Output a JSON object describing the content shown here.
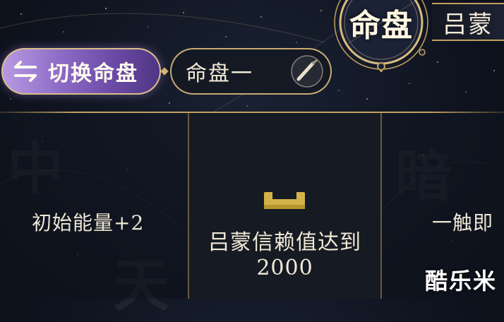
{
  "header": {
    "switch_label": "切换命盘",
    "chart_name": "命盘一",
    "medallion_title": "命盘",
    "character_name": "吕蒙"
  },
  "panels": {
    "left_text": "初始能量+2",
    "mid_line1": "吕蒙信赖值达到",
    "mid_line2": "2000",
    "right_text": "一触即"
  },
  "watermark": "酷乐米",
  "icons": {
    "switch": "swap-arrows-icon",
    "edit": "brush-icon",
    "locked": "chest-icon"
  },
  "colors": {
    "gold": "#c3a063",
    "purple_button": "#8f6ec8",
    "background": "#0f1420"
  }
}
